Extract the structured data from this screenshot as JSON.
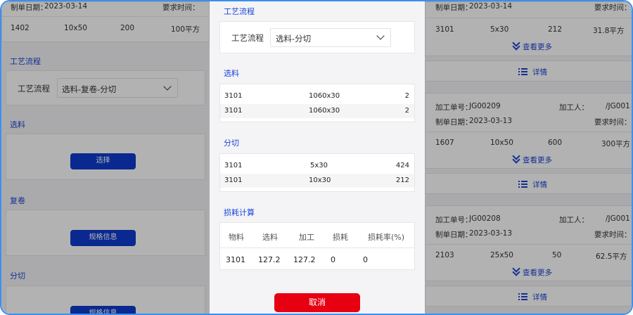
{
  "left": {
    "date_label": "制单日期：",
    "date_value": "2023-03-14",
    "require_label": "要求时间：",
    "row": [
      "1402",
      "10x50",
      "200",
      "100平方"
    ],
    "process_section": "工艺流程",
    "process_label": "工艺流程",
    "process_value": "选料-复卷-分切",
    "select_section": "选料",
    "select_button": "选择",
    "rewind_section": "复卷",
    "rewind_button": "规格信息",
    "slit_section": "分切",
    "slit_button": "规格信息"
  },
  "modal": {
    "process_section": "工艺流程",
    "process_label": "工艺流程",
    "process_value": "选料-分切",
    "material_section": "选料",
    "material_rows": [
      [
        "3101",
        "1060x30",
        "2"
      ],
      [
        "3101",
        "1060x30",
        "2"
      ]
    ],
    "slit_section": "分切",
    "slit_rows": [
      [
        "3101",
        "5x30",
        "424"
      ],
      [
        "3101",
        "10x30",
        "212"
      ]
    ],
    "loss_section": "损耗计算",
    "loss_headers": [
      "物料",
      "选料",
      "加工",
      "损耗",
      "损耗率(%)"
    ],
    "loss_values": [
      "3101",
      "127.2",
      "127.2",
      "0",
      "0"
    ],
    "cancel_button": "取消"
  },
  "right": {
    "top": {
      "date_label": "制单日期：",
      "date_value": "2023-03-14",
      "require_label": "要求时间：",
      "row": [
        "3101",
        "5x30",
        "212",
        "31.8平方"
      ],
      "more": "查看更多",
      "detail": "详情"
    },
    "orders": [
      {
        "order_label": "加工单号：",
        "order_no": "JG00209",
        "worker_label": "加工人：",
        "worker": "/JG001",
        "date_label": "制单日期：",
        "date_value": "2023-03-13",
        "require_label": "要求时间：",
        "row": [
          "1607",
          "10x50",
          "600",
          "300平方"
        ],
        "more": "查看更多",
        "detail": "详情"
      },
      {
        "order_label": "加工单号：",
        "order_no": "JG00208",
        "worker_label": "加工人：",
        "worker": "/JG001",
        "date_label": "制单日期：",
        "date_value": "2023-03-13",
        "require_label": "要求时间：",
        "row": [
          "2103",
          "25x50",
          "50",
          "62.5平方"
        ],
        "more": "查看更多",
        "detail": "详情"
      }
    ]
  },
  "colors": {
    "accent_blue": "#1a44d6",
    "button_blue": "#0d3ccf",
    "cancel_red": "#e60012",
    "frame_border": "#3b8ff0"
  }
}
